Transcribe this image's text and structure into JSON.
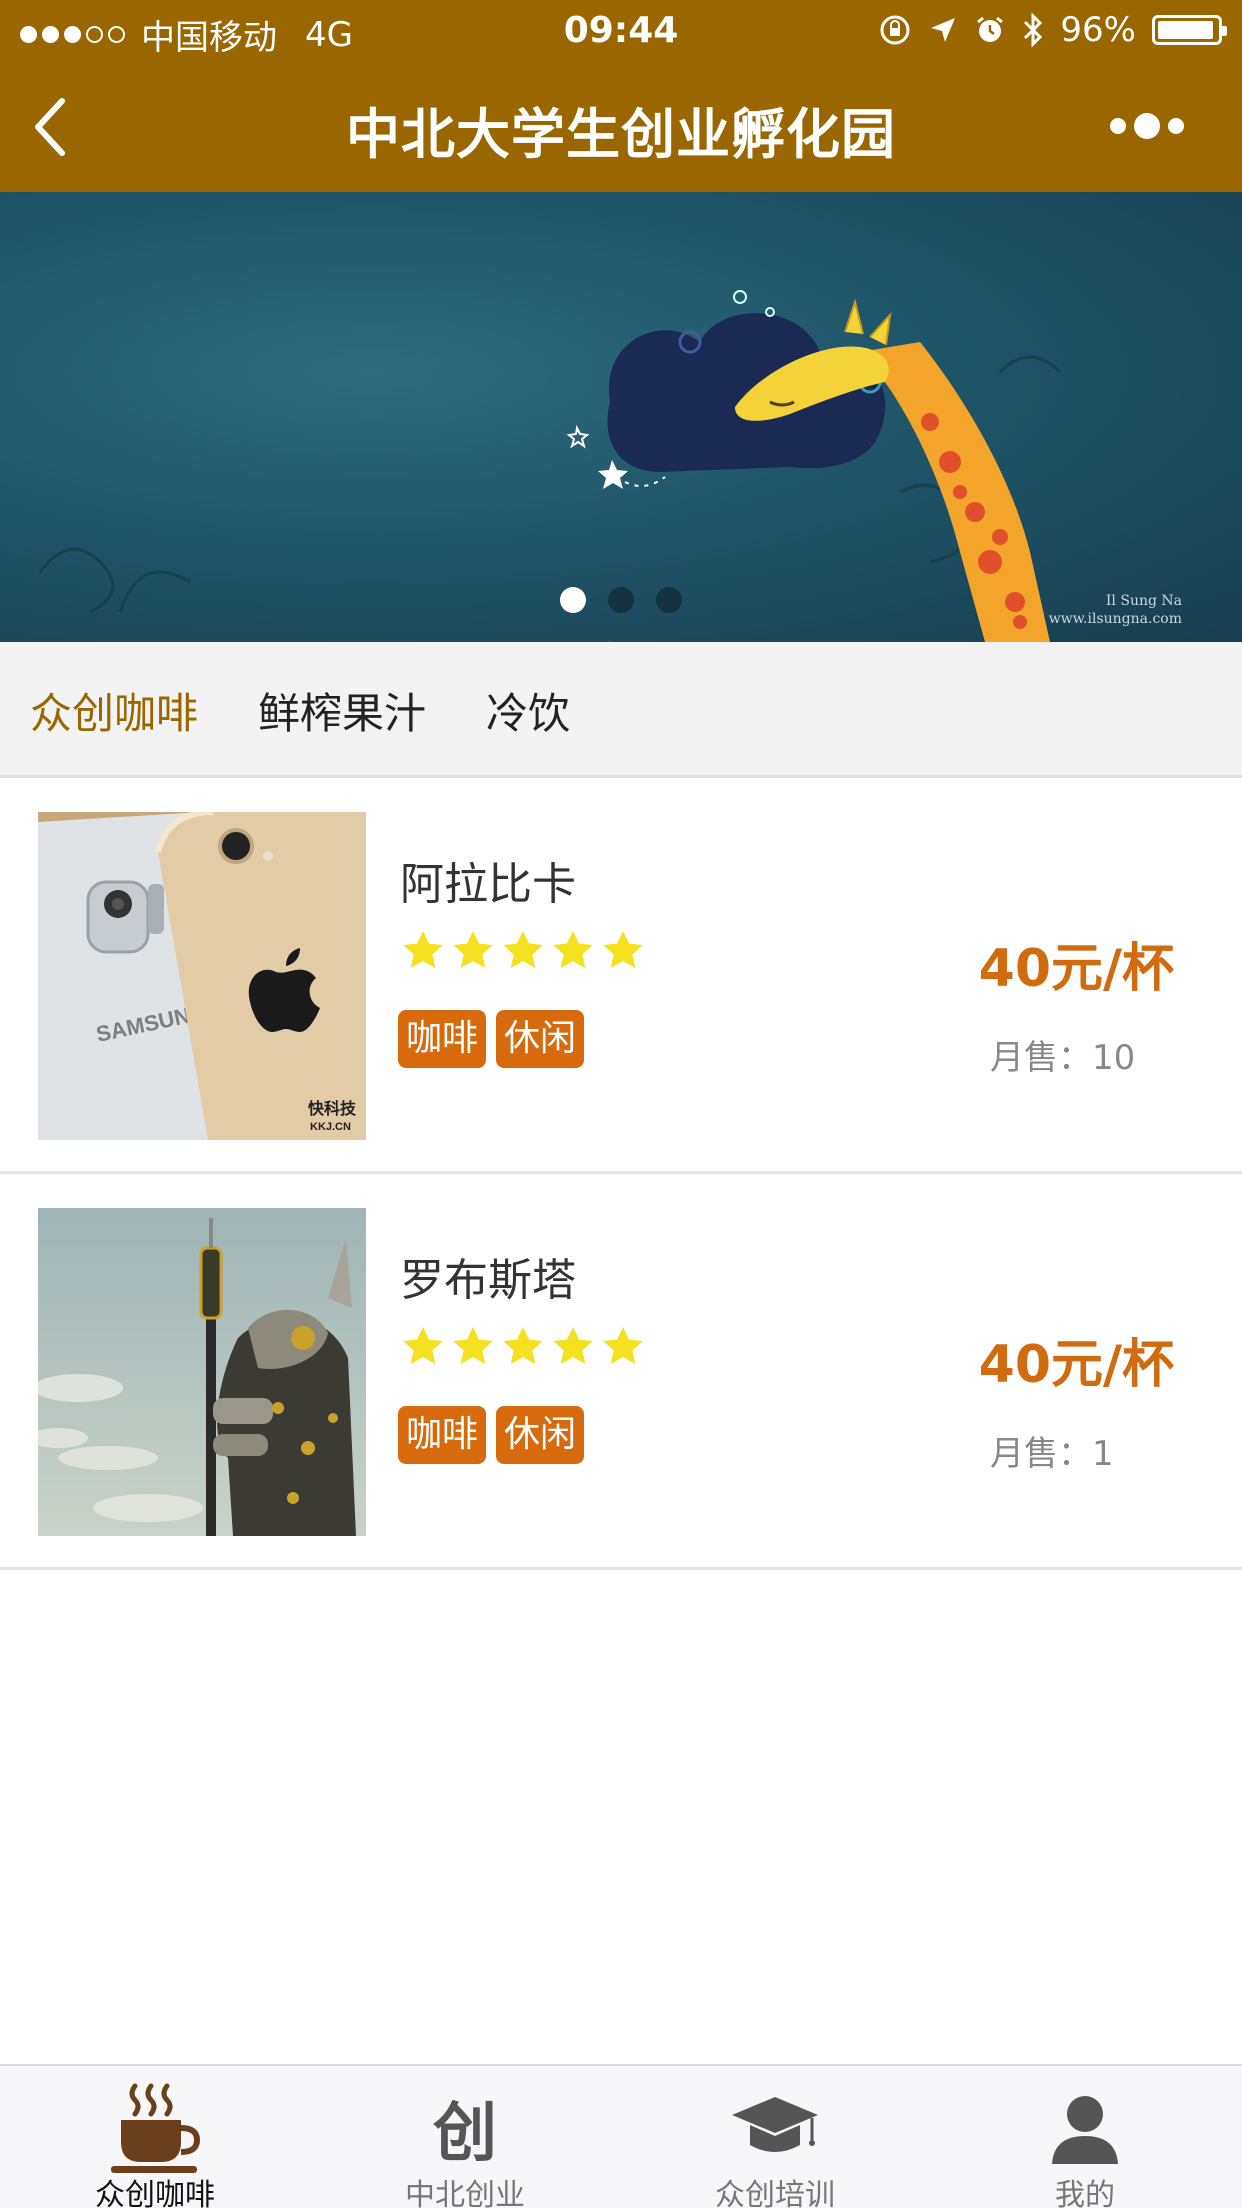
{
  "status_bar": {
    "carrier": "中国移动",
    "network": "4G",
    "time": "09:44",
    "battery": "96%"
  },
  "navbar": {
    "title": "中北大学生创业孵化园",
    "back_icon": "chevron-left-icon",
    "more_icon": "more-dots-icon"
  },
  "banner": {
    "slides": 3,
    "active_slide": 1,
    "watermark_line1": "Il Sung Na",
    "watermark_line2": "www.ilsungna.com"
  },
  "category_tabs": [
    {
      "label": "众创咖啡",
      "active": true
    },
    {
      "label": "鲜榨果汁",
      "active": false
    },
    {
      "label": "冷饮",
      "active": false
    }
  ],
  "products": [
    {
      "name": "阿拉比卡",
      "rating": 5,
      "tags": [
        "咖啡",
        "休闲"
      ],
      "price": "40元/杯",
      "sales": "月售：10",
      "thumb_brand_left": "SAMSUNG",
      "thumb_watermark": "快科技",
      "thumb_watermark_sub": "KKJ.CN"
    },
    {
      "name": "罗布斯塔",
      "rating": 5,
      "tags": [
        "咖啡",
        "休闲"
      ],
      "price": "40元/杯",
      "sales": "月售：1"
    }
  ],
  "tabbar": [
    {
      "label": "众创咖啡",
      "icon": "coffee-cup-icon",
      "active": true
    },
    {
      "label": "中北创业",
      "icon": "chuang-character-icon",
      "glyph": "创",
      "active": false
    },
    {
      "label": "众创培训",
      "icon": "graduation-cap-icon",
      "active": false
    },
    {
      "label": "我的",
      "icon": "user-icon",
      "active": false
    }
  ],
  "colors": {
    "brand": "#996600",
    "price": "#d06b10",
    "tag_bg": "#d86a0e",
    "star": "#f5e11f"
  }
}
